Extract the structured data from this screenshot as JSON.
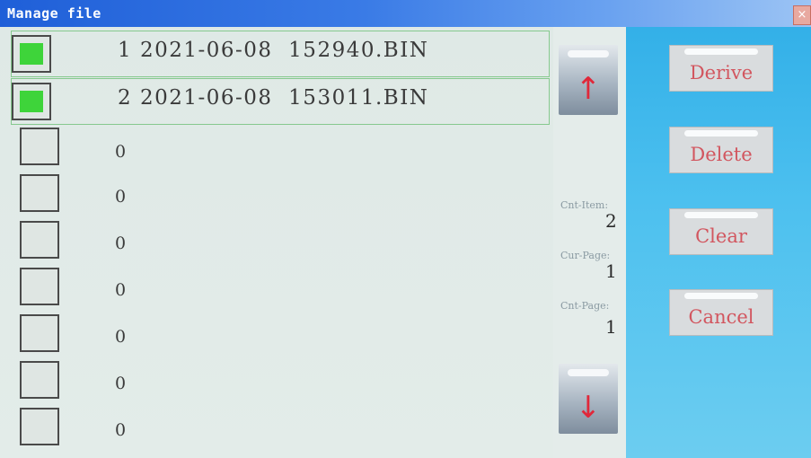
{
  "window": {
    "title": "Manage file",
    "close_symbol": "×"
  },
  "files": [
    {
      "text": "1 2021-06-08  152940.BIN",
      "checked": true
    },
    {
      "text": "2 2021-06-08  153011.BIN",
      "checked": true
    },
    {
      "text": "0",
      "checked": false
    },
    {
      "text": "0",
      "checked": false
    },
    {
      "text": "0",
      "checked": false
    },
    {
      "text": "0",
      "checked": false
    },
    {
      "text": "0",
      "checked": false
    },
    {
      "text": "0",
      "checked": false
    },
    {
      "text": "0",
      "checked": false
    }
  ],
  "scroll": {
    "up_icon": "arrow-up-icon",
    "up_symbol": "↑",
    "down_icon": "arrow-down-icon",
    "down_symbol": "↓"
  },
  "stats": {
    "cnt_item_label": "Cnt-Item:",
    "cnt_item_value": "2",
    "cur_page_label": "Cur-Page:",
    "cur_page_value": "1",
    "cnt_page_label": "Cnt-Page:",
    "cnt_page_value": "1"
  },
  "actions": {
    "derive": "Derive",
    "delete": "Delete",
    "clear": "Clear",
    "cancel": "Cancel"
  },
  "colors": {
    "title_bar": "#1f5fd8",
    "side_panel": "#33b0e8",
    "check_fill": "#3ed43a",
    "arrow": "#e0283a",
    "action_text": "#d2565f"
  }
}
